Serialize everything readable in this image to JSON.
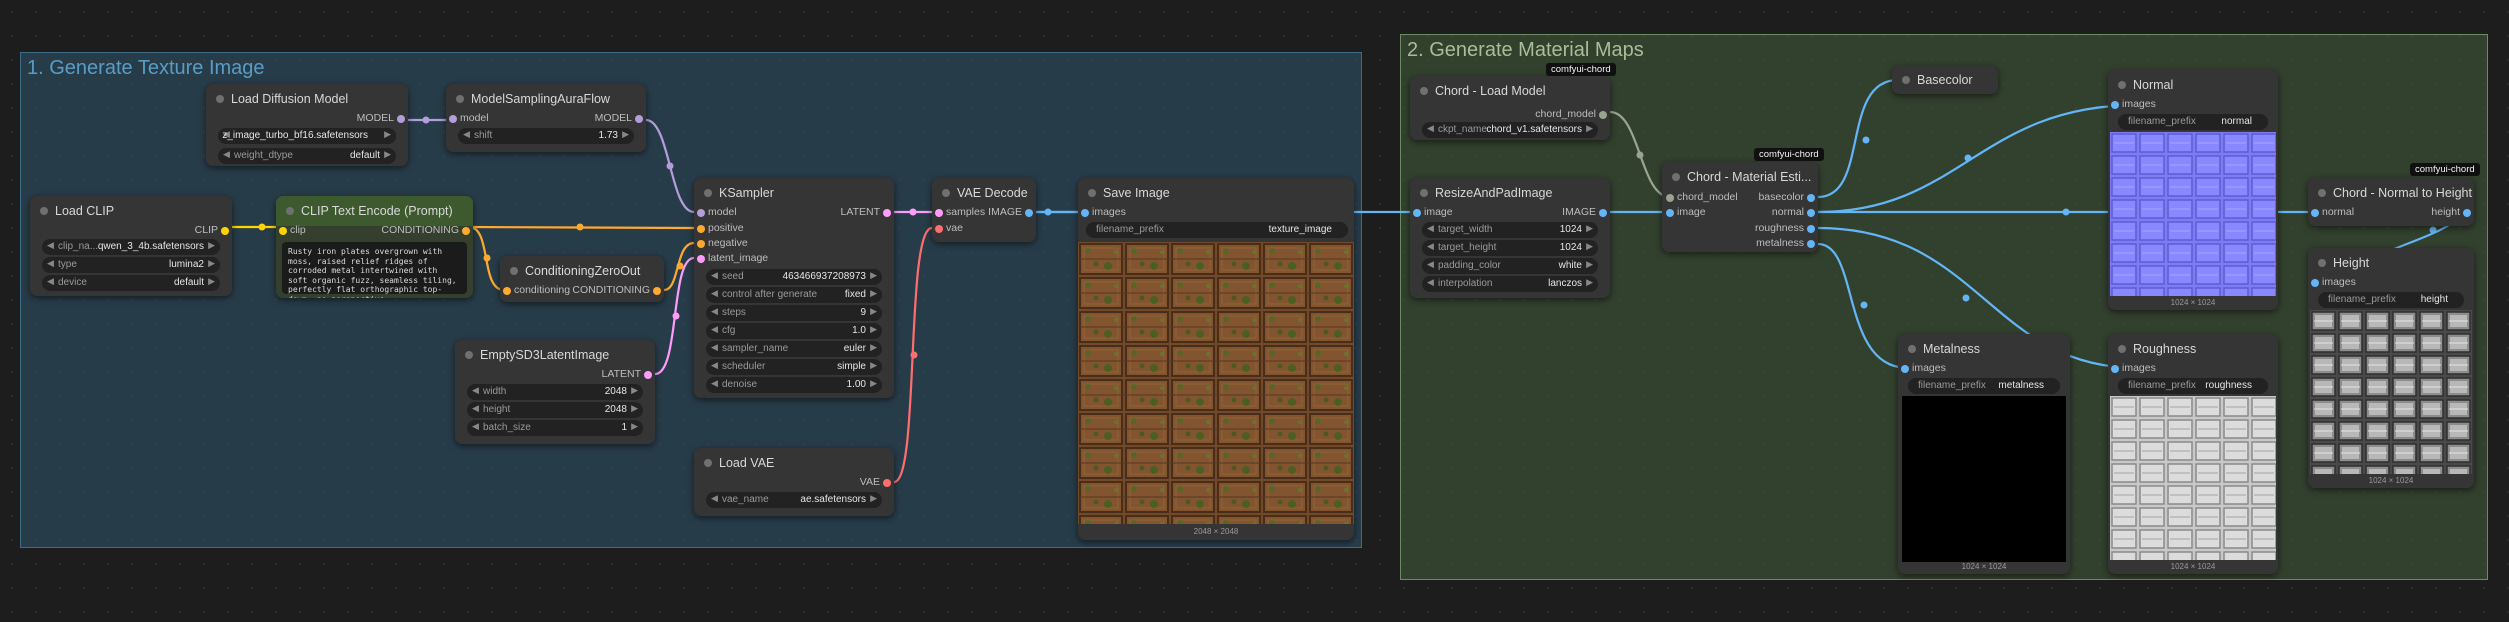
{
  "colors": {
    "model": "#b39ddb",
    "clip": "#ffd500",
    "conditioning": "#ffa931",
    "latent": "#ff9cf9",
    "image": "#64b5f6",
    "vae": "#ff6e6e"
  },
  "groups": [
    {
      "title": "1. Generate Texture Image"
    },
    {
      "title": "2. Generate Material Maps"
    }
  ],
  "badges": {
    "chord_load": "comfyui-chord",
    "chord_estimate": "comfyui-chord",
    "chord_height": "comfyui-chord"
  },
  "nodes": {
    "load_diffusion": {
      "title": "Load Diffusion Model",
      "out": "MODEL",
      "unet_name": "z_image_turbo_bf16.safetensors",
      "weight_dtype_label": "weight_dtype",
      "weight_dtype": "default"
    },
    "model_sampling": {
      "title": "ModelSamplingAuraFlow",
      "in": "model",
      "out": "MODEL",
      "shift_label": "shift",
      "shift": "1.73"
    },
    "load_clip": {
      "title": "Load CLIP",
      "out": "CLIP",
      "clip_name_label": "clip_na...",
      "clip_name": "qwen_3_4b.safetensors",
      "type_label": "type",
      "type": "lumina2",
      "device_label": "device",
      "device": "default"
    },
    "clip_text": {
      "title": "CLIP Text Encode (Prompt)",
      "in": "clip",
      "out": "CONDITIONING",
      "text": "Rusty iron plates overgrown with moss, raised relief ridges of corroded metal intertwined with soft organic fuzz, seamless tiling, perfectly flat orthographic top-down, no perspective"
    },
    "cond_zero": {
      "title": "ConditioningZeroOut",
      "in": "conditioning",
      "out": "CONDITIONING"
    },
    "empty_latent": {
      "title": "EmptySD3LatentImage",
      "out": "LATENT",
      "width_label": "width",
      "width": "2048",
      "height_label": "height",
      "height": "2048",
      "batch_label": "batch_size",
      "batch": "1"
    },
    "ksampler": {
      "title": "KSampler",
      "in_model": "model",
      "in_positive": "positive",
      "in_negative": "negative",
      "in_latent": "latent_image",
      "out": "LATENT",
      "widgets": [
        {
          "label": "seed",
          "value": "463466937208973"
        },
        {
          "label": "control after generate",
          "value": "fixed"
        },
        {
          "label": "steps",
          "value": "9"
        },
        {
          "label": "cfg",
          "value": "1.0"
        },
        {
          "label": "sampler_name",
          "value": "euler"
        },
        {
          "label": "scheduler",
          "value": "simple"
        },
        {
          "label": "denoise",
          "value": "1.00"
        }
      ]
    },
    "vae_decode": {
      "title": "VAE Decode",
      "in_samples": "samples",
      "in_vae": "vae",
      "out": "IMAGE"
    },
    "load_vae": {
      "title": "Load VAE",
      "out": "VAE",
      "vae_label": "vae_name",
      "vae_name": "ae.safetensors"
    },
    "save_image": {
      "title": "Save Image",
      "in": "images",
      "prefix_label": "filename_prefix",
      "prefix": "texture_image",
      "caption": "2048 × 2048"
    },
    "chord_load": {
      "title": "Chord - Load Model",
      "out": "chord_model",
      "ckpt_label": "ckpt_name",
      "ckpt": "chord_v1.safetensors"
    },
    "resize_pad": {
      "title": "ResizeAndPadImage",
      "in": "image",
      "out": "IMAGE",
      "widgets": [
        {
          "label": "target_width",
          "value": "1024"
        },
        {
          "label": "target_height",
          "value": "1024"
        },
        {
          "label": "padding_color",
          "value": "white"
        },
        {
          "label": "interpolation",
          "value": "lanczos"
        }
      ]
    },
    "chord_estimate": {
      "title": "Chord - Material Esti...",
      "in_model": "chord_model",
      "in_image": "image",
      "outs": [
        "basecolor",
        "normal",
        "roughness",
        "metalness"
      ]
    },
    "basecolor": {
      "title": "Basecolor"
    },
    "normal": {
      "title": "Normal",
      "in": "images",
      "prefix_label": "filename_prefix",
      "prefix": "normal",
      "caption": "1024 × 1024"
    },
    "metalness": {
      "title": "Metalness",
      "in": "images",
      "prefix_label": "filename_prefix",
      "prefix": "metalness",
      "caption": "1024 × 1024"
    },
    "roughness": {
      "title": "Roughness",
      "in": "images",
      "prefix_label": "filename_prefix",
      "prefix": "roughness",
      "caption": "1024 × 1024"
    },
    "chord_height": {
      "title": "Chord - Normal to Height",
      "in": "normal",
      "out": "height"
    },
    "height_preview": {
      "title": "Height",
      "in": "images",
      "prefix_label": "filename_prefix",
      "prefix": "height",
      "caption": "1024 × 1024"
    }
  }
}
